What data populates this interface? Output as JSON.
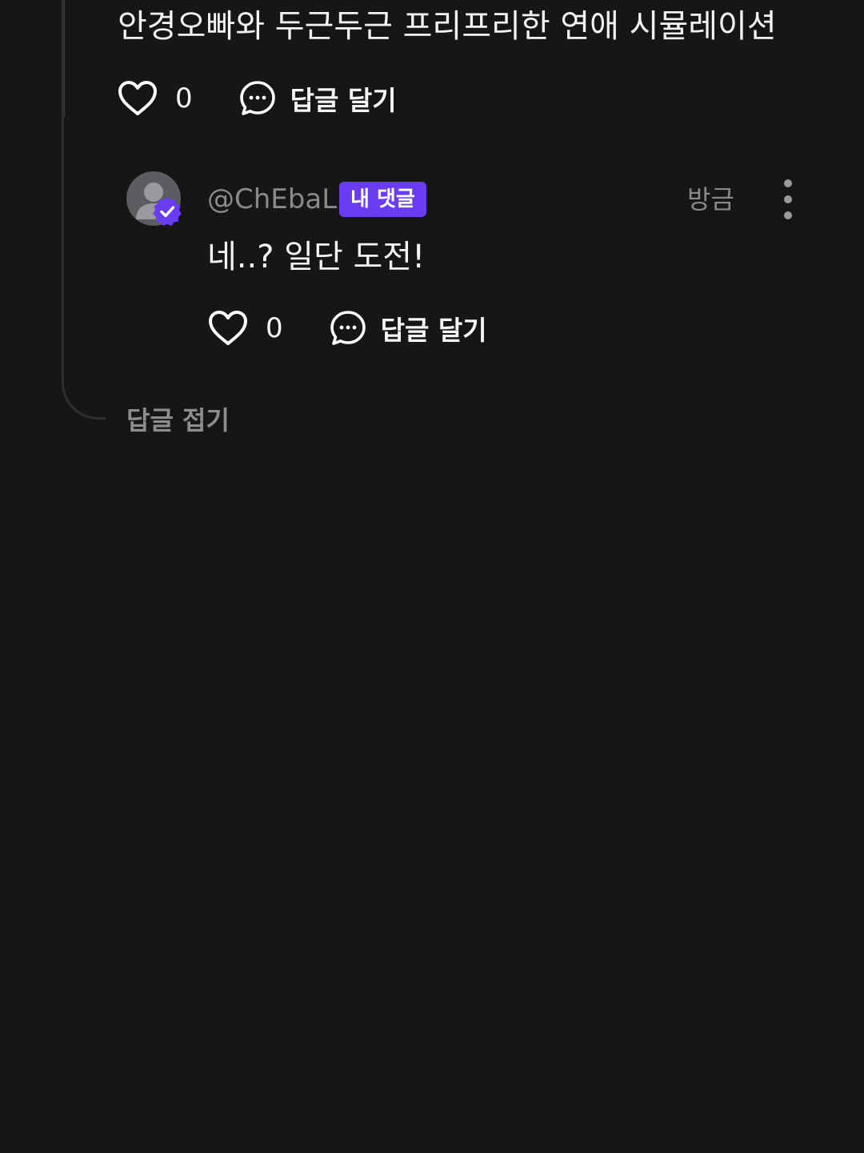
{
  "parent_comment": {
    "text": "안경오빠와 두근두근 프리프리한 연애 시뮬레이션",
    "like_count": "0",
    "reply_label": "답글 달기"
  },
  "reply_comment": {
    "username": "@ChEbaL",
    "badge": "내 댓글",
    "timestamp": "방금",
    "text": "네..? 일단 도전!",
    "like_count": "0",
    "reply_label": "답글 달기"
  },
  "thread": {
    "collapse_label": "답글 접기"
  },
  "icons": {
    "like": "heart-icon",
    "reply": "speech-bubble-icon",
    "more": "more-vertical-icon",
    "verified": "verified-check-icon",
    "avatar": "default-user-avatar"
  },
  "colors": {
    "background": "#161617",
    "accent": "#6a3df2",
    "muted_text": "#8a8a8e"
  }
}
